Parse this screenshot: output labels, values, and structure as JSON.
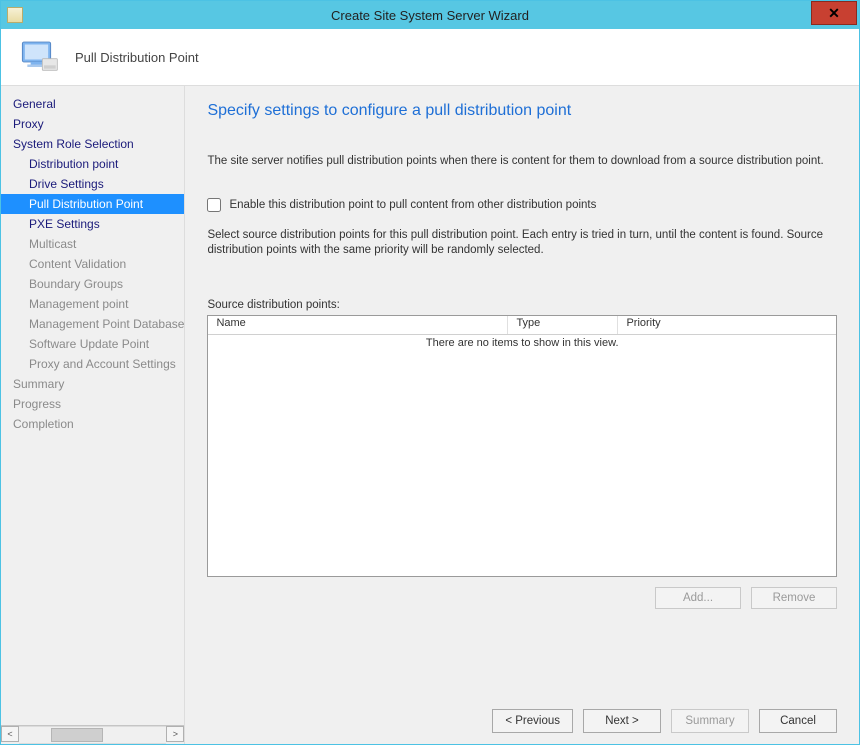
{
  "titlebar": {
    "title": "Create Site System Server Wizard",
    "close_glyph": "✕"
  },
  "header": {
    "subtitle": "Pull Distribution Point"
  },
  "nav": {
    "items": [
      {
        "label": "General",
        "sub": false,
        "sel": false,
        "muted": false
      },
      {
        "label": "Proxy",
        "sub": false,
        "sel": false,
        "muted": false
      },
      {
        "label": "System Role Selection",
        "sub": false,
        "sel": false,
        "muted": false
      },
      {
        "label": "Distribution point",
        "sub": true,
        "sel": false,
        "muted": false
      },
      {
        "label": "Drive Settings",
        "sub": true,
        "sel": false,
        "muted": false
      },
      {
        "label": "Pull Distribution Point",
        "sub": true,
        "sel": true,
        "muted": false
      },
      {
        "label": "PXE Settings",
        "sub": true,
        "sel": false,
        "muted": false
      },
      {
        "label": "Multicast",
        "sub": true,
        "sel": false,
        "muted": true
      },
      {
        "label": "Content Validation",
        "sub": true,
        "sel": false,
        "muted": true
      },
      {
        "label": "Boundary Groups",
        "sub": true,
        "sel": false,
        "muted": true
      },
      {
        "label": "Management point",
        "sub": true,
        "sel": false,
        "muted": true
      },
      {
        "label": "Management Point Database",
        "sub": true,
        "sel": false,
        "muted": true
      },
      {
        "label": "Software Update Point",
        "sub": true,
        "sel": false,
        "muted": true
      },
      {
        "label": "Proxy and Account Settings",
        "sub": true,
        "sel": false,
        "muted": true
      },
      {
        "label": "Summary",
        "sub": false,
        "sel": false,
        "muted": true
      },
      {
        "label": "Progress",
        "sub": false,
        "sel": false,
        "muted": true
      },
      {
        "label": "Completion",
        "sub": false,
        "sel": false,
        "muted": true
      }
    ],
    "scroll_glyph_left": "<",
    "scroll_glyph_right": ">",
    "scroll_thumb_glyph": "|||"
  },
  "main": {
    "title": "Specify settings to configure a pull distribution point",
    "desc1": "The site server notifies pull distribution points when there is content for them to download from a source distribution point.",
    "checkbox_label": "Enable this distribution point to pull content from other distribution points",
    "checkbox_checked": false,
    "desc2": "Select source distribution points for this pull distribution point. Each entry is tried in turn, until the content is found. Source distribution points with the same priority will be randomly selected.",
    "table_label": "Source distribution points:",
    "columns": {
      "c1": "Name",
      "c2": "Type",
      "c3": "Priority"
    },
    "empty_text": "There are no items to show in this view.",
    "add_label": "Add...",
    "remove_label": "Remove"
  },
  "footer": {
    "previous": "< Previous",
    "next": "Next >",
    "summary": "Summary",
    "cancel": "Cancel"
  }
}
